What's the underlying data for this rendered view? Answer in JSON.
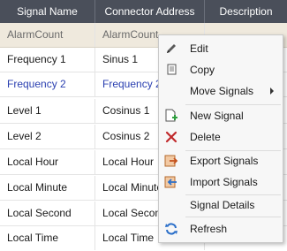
{
  "columns": [
    "Signal Name",
    "Connector Address",
    "Description"
  ],
  "filter_row": [
    "AlarmCount",
    "AlarmCount"
  ],
  "rows": [
    {
      "name": "Frequency 1",
      "address": "Sinus 1"
    },
    {
      "name": "Frequency 2",
      "address": "Frequency 2"
    },
    {
      "name": "Level 1",
      "address": "Cosinus 1"
    },
    {
      "name": "Level 2",
      "address": "Cosinus 2"
    },
    {
      "name": "Local Hour",
      "address": "Local Hour"
    },
    {
      "name": "Local Minute",
      "address": "Local Minute"
    },
    {
      "name": "Local Second",
      "address": "Local Second"
    },
    {
      "name": "Local Time",
      "address": "Local Time"
    }
  ],
  "context_menu": {
    "edit": "Edit",
    "copy": "Copy",
    "move_signals": "Move Signals",
    "new_signal": "New Signal",
    "delete": "Delete",
    "export_signals": "Export Signals",
    "import_signals": "Import Signals",
    "signal_details": "Signal Details",
    "refresh": "Refresh"
  },
  "colors": {
    "header_bg": "#4a4f5a",
    "filter_bg": "#efe9dd",
    "selected_text": "#2a3fb0"
  }
}
